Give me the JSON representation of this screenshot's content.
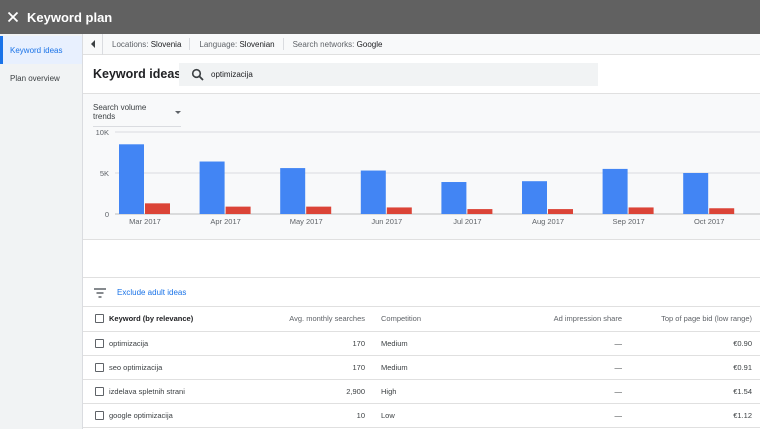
{
  "app": {
    "title": "Keyword plan"
  },
  "sidebar": {
    "items": [
      {
        "label": "Keyword ideas",
        "active": true
      },
      {
        "label": "Plan overview",
        "active": false
      }
    ]
  },
  "filters": {
    "location_label": "Locations:",
    "location_value": "Slovenia",
    "language_label": "Language:",
    "language_value": "Slovenian",
    "network_label": "Search networks:",
    "network_value": "Google"
  },
  "page": {
    "title": "Keyword ideas"
  },
  "search": {
    "value": "optimizacija"
  },
  "trend": {
    "selector_label": "Search volume trends"
  },
  "chart_data": {
    "type": "bar",
    "categories": [
      "Mar 2017",
      "Apr 2017",
      "May 2017",
      "Jun 2017",
      "Jul 2017",
      "Aug 2017",
      "Sep 2017",
      "Oct 2017"
    ],
    "y_ticks": [
      "0",
      "5K",
      "10K"
    ],
    "ylim": [
      0,
      10000
    ],
    "grid": true,
    "series": [
      {
        "color": "#4285f4",
        "values": [
          8500,
          6400,
          5600,
          5300,
          3900,
          4000,
          5500,
          5000
        ]
      },
      {
        "color": "#db4437",
        "values": [
          1300,
          900,
          900,
          800,
          600,
          600,
          800,
          700
        ]
      }
    ]
  },
  "toolbar": {
    "exclude_label": "Exclude adult ideas"
  },
  "table": {
    "headers": {
      "keyword": "Keyword (by relevance)",
      "searches": "Avg. monthly searches",
      "competition": "Competition",
      "impression": "Ad impression share",
      "bid": "Top of page bid (low range)"
    },
    "rows": [
      {
        "keyword": "optimizacija",
        "searches": "170",
        "competition": "Medium",
        "impression": "—",
        "bid": "€0.90"
      },
      {
        "keyword": "seo optimizacija",
        "searches": "170",
        "competition": "Medium",
        "impression": "—",
        "bid": "€0.91"
      },
      {
        "keyword": "izdelava spletnih strani",
        "searches": "2,900",
        "competition": "High",
        "impression": "—",
        "bid": "€1.54"
      },
      {
        "keyword": "google optimizacija",
        "searches": "10",
        "competition": "Low",
        "impression": "—",
        "bid": "€1.12"
      }
    ]
  },
  "icons": {
    "close": "close-icon",
    "search": "search-icon",
    "filter": "filter-icon",
    "back": "chevron-left-icon"
  }
}
